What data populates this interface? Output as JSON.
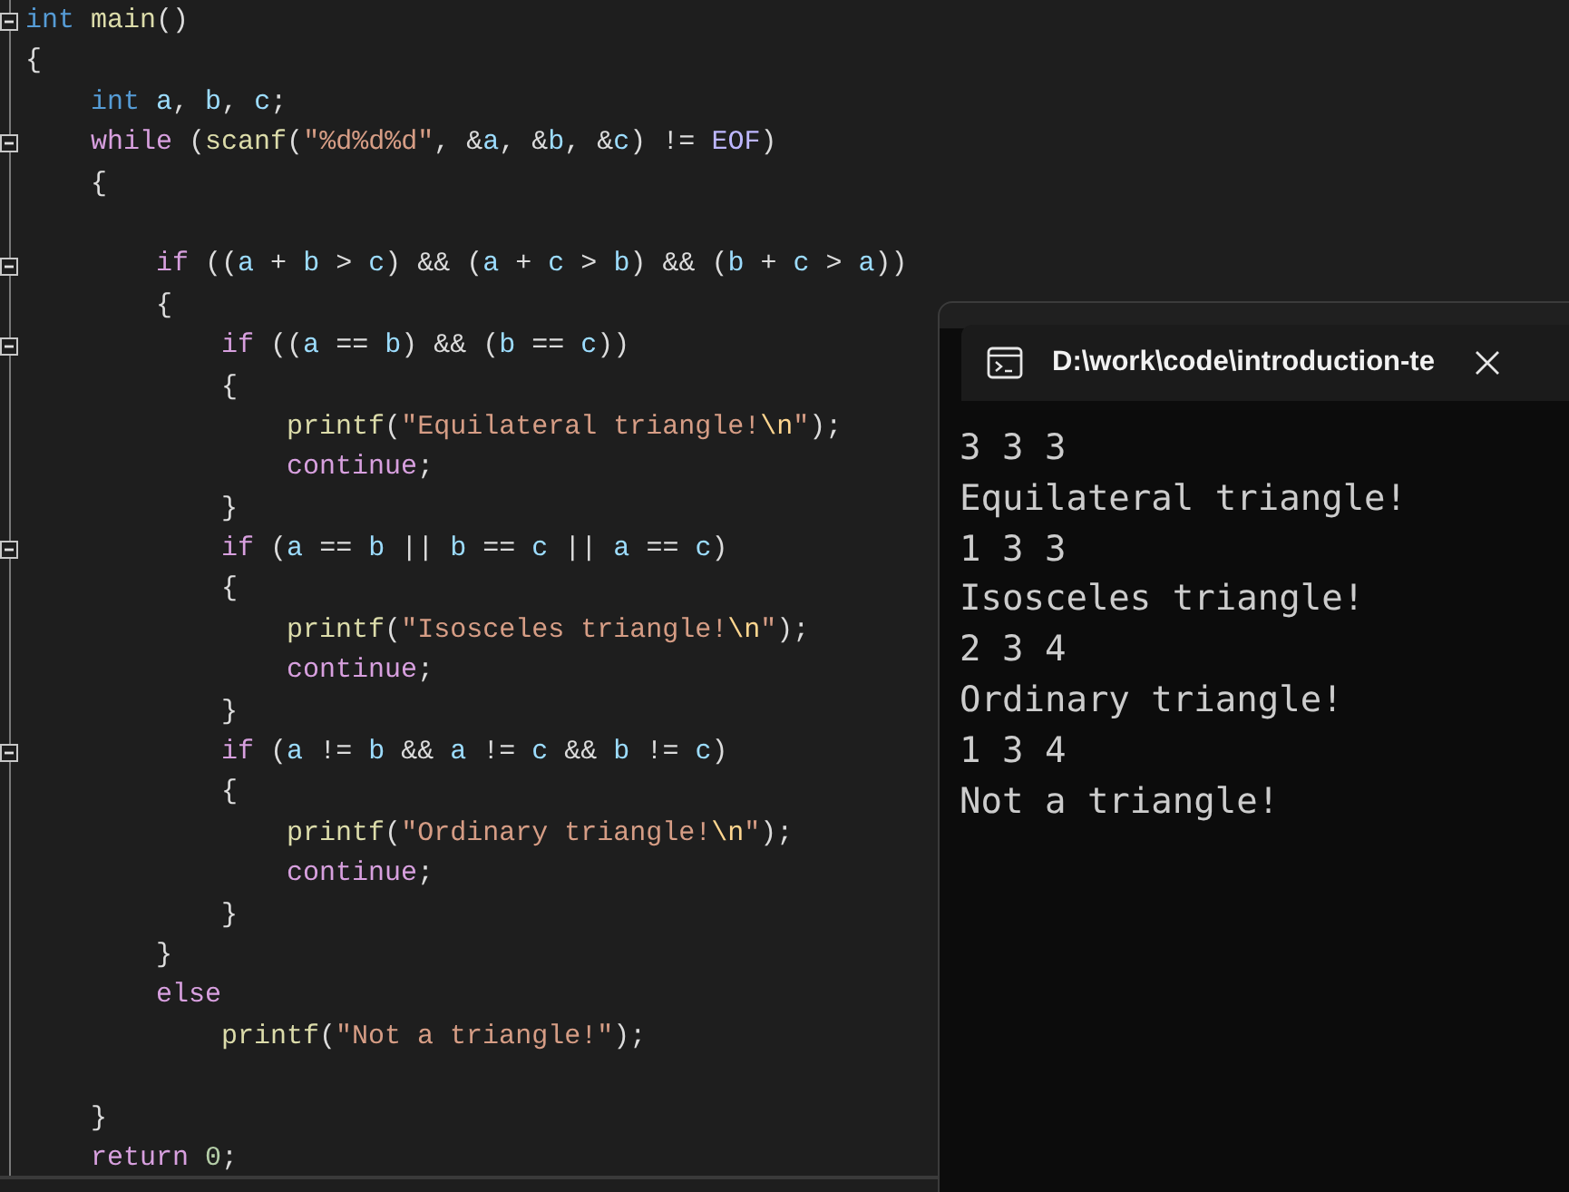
{
  "editor": {
    "lines": [
      {
        "fold": true,
        "tokens": [
          {
            "kind": "type",
            "text": "int"
          },
          {
            "kind": "fn",
            "text": " main"
          },
          {
            "kind": "punct",
            "text": "()"
          }
        ]
      },
      {
        "fold": false,
        "tokens": [
          {
            "kind": "punct",
            "text": "{"
          }
        ]
      },
      {
        "fold": false,
        "tokens": [
          {
            "kind": "type",
            "text": "    int"
          },
          {
            "kind": "var",
            "text": " a"
          },
          {
            "kind": "punct",
            "text": ", "
          },
          {
            "kind": "var",
            "text": "b"
          },
          {
            "kind": "punct",
            "text": ", "
          },
          {
            "kind": "var",
            "text": "c"
          },
          {
            "kind": "punct",
            "text": ";"
          }
        ]
      },
      {
        "fold": true,
        "tokens": [
          {
            "kind": "kw",
            "text": "    while"
          },
          {
            "kind": "punct",
            "text": " ("
          },
          {
            "kind": "fn",
            "text": "scanf"
          },
          {
            "kind": "punct",
            "text": "("
          },
          {
            "kind": "str",
            "text": "\"%d%d%d\""
          },
          {
            "kind": "punct",
            "text": ", &"
          },
          {
            "kind": "var",
            "text": "a"
          },
          {
            "kind": "punct",
            "text": ", &"
          },
          {
            "kind": "var",
            "text": "b"
          },
          {
            "kind": "punct",
            "text": ", &"
          },
          {
            "kind": "var",
            "text": "c"
          },
          {
            "kind": "punct",
            "text": ") != "
          },
          {
            "kind": "macro",
            "text": "EOF"
          },
          {
            "kind": "punct",
            "text": ")"
          }
        ]
      },
      {
        "fold": false,
        "tokens": [
          {
            "kind": "punct",
            "text": "    {"
          }
        ]
      },
      {
        "fold": false
      },
      {
        "fold": true,
        "tokens": [
          {
            "kind": "kw",
            "text": "        if"
          },
          {
            "kind": "punct",
            "text": " (("
          },
          {
            "kind": "var",
            "text": "a"
          },
          {
            "kind": "punct",
            "text": " + "
          },
          {
            "kind": "var",
            "text": "b"
          },
          {
            "kind": "punct",
            "text": " > "
          },
          {
            "kind": "var",
            "text": "c"
          },
          {
            "kind": "punct",
            "text": ") && ("
          },
          {
            "kind": "var",
            "text": "a"
          },
          {
            "kind": "punct",
            "text": " + "
          },
          {
            "kind": "var",
            "text": "c"
          },
          {
            "kind": "punct",
            "text": " > "
          },
          {
            "kind": "var",
            "text": "b"
          },
          {
            "kind": "punct",
            "text": ") && ("
          },
          {
            "kind": "var",
            "text": "b"
          },
          {
            "kind": "punct",
            "text": " + "
          },
          {
            "kind": "var",
            "text": "c"
          },
          {
            "kind": "punct",
            "text": " > "
          },
          {
            "kind": "var",
            "text": "a"
          },
          {
            "kind": "punct",
            "text": "))"
          }
        ]
      },
      {
        "fold": false,
        "tokens": [
          {
            "kind": "punct",
            "text": "        {"
          }
        ]
      },
      {
        "fold": true,
        "tokens": [
          {
            "kind": "kw",
            "text": "            if"
          },
          {
            "kind": "punct",
            "text": " (("
          },
          {
            "kind": "var",
            "text": "a"
          },
          {
            "kind": "punct",
            "text": " == "
          },
          {
            "kind": "var",
            "text": "b"
          },
          {
            "kind": "punct",
            "text": ") && ("
          },
          {
            "kind": "var",
            "text": "b"
          },
          {
            "kind": "punct",
            "text": " == "
          },
          {
            "kind": "var",
            "text": "c"
          },
          {
            "kind": "punct",
            "text": "))"
          }
        ]
      },
      {
        "fold": false,
        "tokens": [
          {
            "kind": "punct",
            "text": "            {"
          }
        ]
      },
      {
        "fold": false,
        "tokens": [
          {
            "kind": "fn",
            "text": "                printf"
          },
          {
            "kind": "punct",
            "text": "("
          },
          {
            "kind": "str",
            "text": "\"Equilateral triangle!"
          },
          {
            "kind": "esc",
            "text": "\\n"
          },
          {
            "kind": "str",
            "text": "\""
          },
          {
            "kind": "punct",
            "text": ");"
          }
        ]
      },
      {
        "fold": false,
        "tokens": [
          {
            "kind": "kw",
            "text": "                continue"
          },
          {
            "kind": "punct",
            "text": ";"
          }
        ]
      },
      {
        "fold": false,
        "tokens": [
          {
            "kind": "punct",
            "text": "            }"
          }
        ]
      },
      {
        "fold": true,
        "tokens": [
          {
            "kind": "kw",
            "text": "            if"
          },
          {
            "kind": "punct",
            "text": " ("
          },
          {
            "kind": "var",
            "text": "a"
          },
          {
            "kind": "punct",
            "text": " == "
          },
          {
            "kind": "var",
            "text": "b"
          },
          {
            "kind": "punct",
            "text": " || "
          },
          {
            "kind": "var",
            "text": "b"
          },
          {
            "kind": "punct",
            "text": " == "
          },
          {
            "kind": "var",
            "text": "c"
          },
          {
            "kind": "punct",
            "text": " || "
          },
          {
            "kind": "var",
            "text": "a"
          },
          {
            "kind": "punct",
            "text": " == "
          },
          {
            "kind": "var",
            "text": "c"
          },
          {
            "kind": "punct",
            "text": ")"
          }
        ]
      },
      {
        "fold": false,
        "tokens": [
          {
            "kind": "punct",
            "text": "            {"
          }
        ]
      },
      {
        "fold": false,
        "tokens": [
          {
            "kind": "fn",
            "text": "                printf"
          },
          {
            "kind": "punct",
            "text": "("
          },
          {
            "kind": "str",
            "text": "\"Isosceles triangle!"
          },
          {
            "kind": "esc",
            "text": "\\n"
          },
          {
            "kind": "str",
            "text": "\""
          },
          {
            "kind": "punct",
            "text": ");"
          }
        ]
      },
      {
        "fold": false,
        "tokens": [
          {
            "kind": "kw",
            "text": "                continue"
          },
          {
            "kind": "punct",
            "text": ";"
          }
        ]
      },
      {
        "fold": false,
        "tokens": [
          {
            "kind": "punct",
            "text": "            }"
          }
        ]
      },
      {
        "fold": true,
        "tokens": [
          {
            "kind": "kw",
            "text": "            if"
          },
          {
            "kind": "punct",
            "text": " ("
          },
          {
            "kind": "var",
            "text": "a"
          },
          {
            "kind": "punct",
            "text": " != "
          },
          {
            "kind": "var",
            "text": "b"
          },
          {
            "kind": "punct",
            "text": " && "
          },
          {
            "kind": "var",
            "text": "a"
          },
          {
            "kind": "punct",
            "text": " != "
          },
          {
            "kind": "var",
            "text": "c"
          },
          {
            "kind": "punct",
            "text": " && "
          },
          {
            "kind": "var",
            "text": "b"
          },
          {
            "kind": "punct",
            "text": " != "
          },
          {
            "kind": "var",
            "text": "c"
          },
          {
            "kind": "punct",
            "text": ")"
          }
        ]
      },
      {
        "fold": false,
        "tokens": [
          {
            "kind": "punct",
            "text": "            {"
          }
        ]
      },
      {
        "fold": false,
        "tokens": [
          {
            "kind": "fn",
            "text": "                printf"
          },
          {
            "kind": "punct",
            "text": "("
          },
          {
            "kind": "str",
            "text": "\"Ordinary triangle!"
          },
          {
            "kind": "esc",
            "text": "\\n"
          },
          {
            "kind": "str",
            "text": "\""
          },
          {
            "kind": "punct",
            "text": ");"
          }
        ]
      },
      {
        "fold": false,
        "tokens": [
          {
            "kind": "kw",
            "text": "                continue"
          },
          {
            "kind": "punct",
            "text": ";"
          }
        ]
      },
      {
        "fold": false,
        "tokens": [
          {
            "kind": "punct",
            "text": "            }"
          }
        ]
      },
      {
        "fold": false,
        "tokens": [
          {
            "kind": "punct",
            "text": "        }"
          }
        ]
      },
      {
        "fold": false,
        "tokens": [
          {
            "kind": "kw",
            "text": "        else"
          }
        ]
      },
      {
        "fold": false,
        "tokens": [
          {
            "kind": "fn",
            "text": "            printf"
          },
          {
            "kind": "punct",
            "text": "("
          },
          {
            "kind": "str",
            "text": "\"Not a triangle!\""
          },
          {
            "kind": "punct",
            "text": ");"
          }
        ]
      },
      {
        "fold": false
      },
      {
        "fold": false,
        "tokens": [
          {
            "kind": "punct",
            "text": "    }"
          }
        ]
      },
      {
        "fold": false,
        "tokens": [
          {
            "kind": "kw",
            "text": "    return"
          },
          {
            "kind": "num",
            "text": " 0"
          },
          {
            "kind": "punct",
            "text": ";"
          }
        ]
      }
    ]
  },
  "console": {
    "tab_title": "D:\\work\\code\\introduction-te",
    "output": [
      "3 3 3",
      "Equilateral triangle!",
      "1 3 3",
      "Isosceles triangle!",
      "2 3 4",
      "Ordinary triangle!",
      "1 3 4",
      "Not a triangle!"
    ]
  }
}
